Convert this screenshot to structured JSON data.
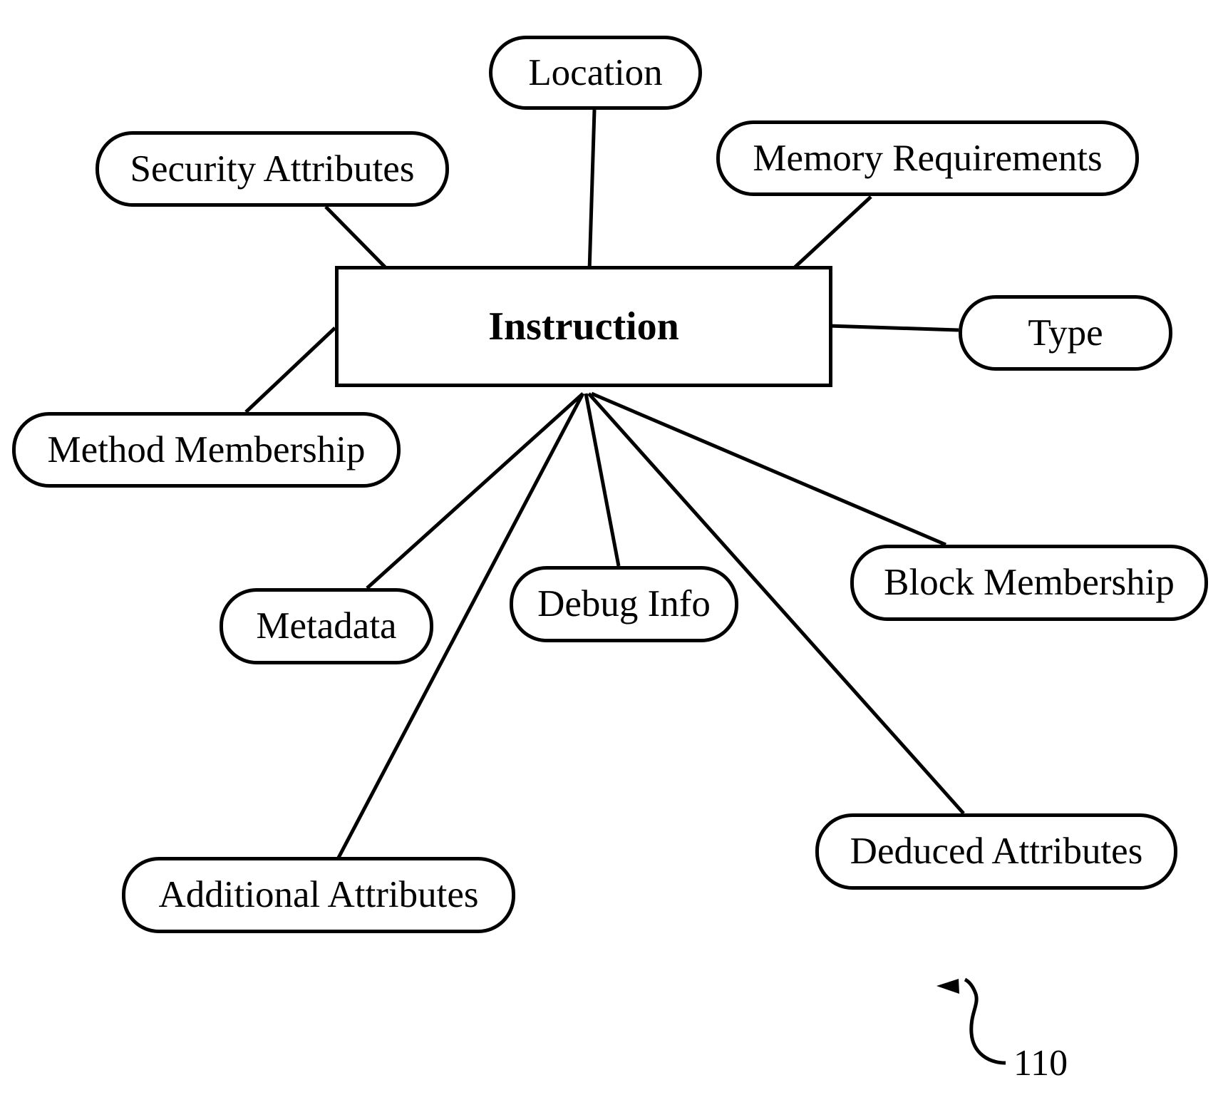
{
  "diagram": {
    "center": {
      "label": "Instruction"
    },
    "nodes": [
      {
        "id": "location",
        "label": "Location"
      },
      {
        "id": "security-attributes",
        "label": "Security Attributes"
      },
      {
        "id": "memory-requirements",
        "label": "Memory Requirements"
      },
      {
        "id": "type",
        "label": "Type"
      },
      {
        "id": "method-membership",
        "label": "Method Membership"
      },
      {
        "id": "metadata",
        "label": "Metadata"
      },
      {
        "id": "debug-info",
        "label": "Debug Info"
      },
      {
        "id": "block-membership",
        "label": "Block Membership"
      },
      {
        "id": "additional-attributes",
        "label": "Additional Attributes"
      },
      {
        "id": "deduced-attributes",
        "label": "Deduced Attributes"
      }
    ],
    "edges": [
      {
        "from": "Instruction",
        "to": "Location"
      },
      {
        "from": "Instruction",
        "to": "Security Attributes"
      },
      {
        "from": "Instruction",
        "to": "Memory Requirements"
      },
      {
        "from": "Instruction",
        "to": "Type"
      },
      {
        "from": "Instruction",
        "to": "Method Membership"
      },
      {
        "from": "Instruction",
        "to": "Metadata"
      },
      {
        "from": "Instruction",
        "to": "Debug Info"
      },
      {
        "from": "Instruction",
        "to": "Block Membership"
      },
      {
        "from": "Instruction",
        "to": "Additional Attributes"
      },
      {
        "from": "Instruction",
        "to": "Deduced Attributes"
      }
    ],
    "reference_numeral": "110"
  }
}
